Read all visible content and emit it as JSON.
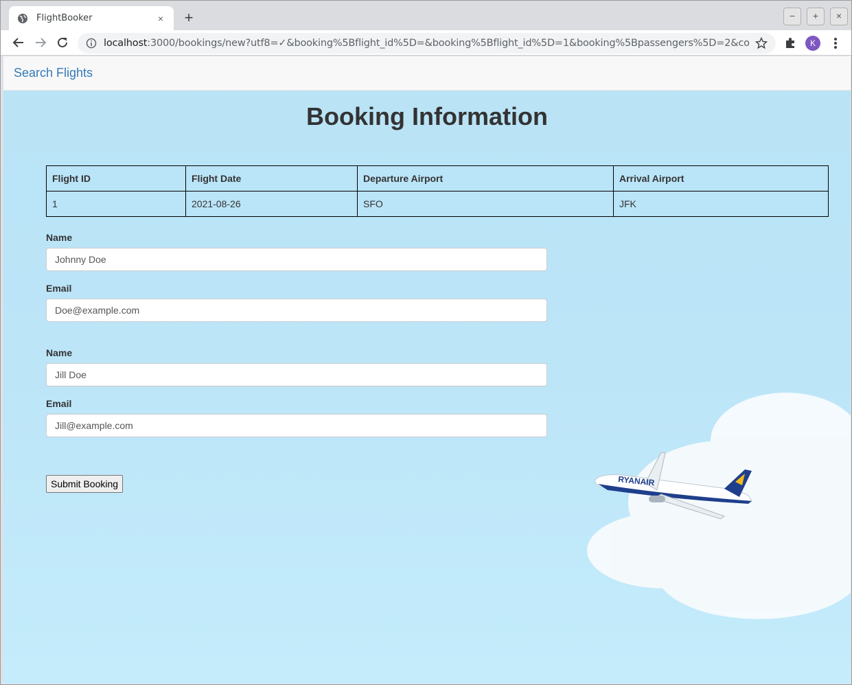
{
  "browser": {
    "tab_title": "FlightBooker",
    "url_host": "localhost",
    "url_rest": ":3000/bookings/new?utf8=✓&booking%5Bflight_id%5D=&booking%5Bflight_id%5D=1&booking%5Bpassengers%5D=2&commit=Co...",
    "profile_initial": "K",
    "win_minimize": "−",
    "win_maximize": "+",
    "win_close": "×",
    "new_tab": "+",
    "tab_close": "×"
  },
  "navbar": {
    "link": "Search Flights"
  },
  "page": {
    "title": "Booking Information"
  },
  "flight_table": {
    "headers": [
      "Flight ID",
      "Flight Date",
      "Departure Airport",
      "Arrival Airport"
    ],
    "row": [
      "1",
      "2021-08-26",
      "SFO",
      "JFK"
    ]
  },
  "passengers": [
    {
      "name_label": "Name",
      "name_value": "Johnny Doe",
      "email_label": "Email",
      "email_value": "Doe@example.com"
    },
    {
      "name_label": "Name",
      "name_value": "Jill Doe",
      "email_label": "Email",
      "email_value": "Jill@example.com"
    }
  ],
  "form": {
    "submit_label": "Submit Booking"
  },
  "colors": {
    "link": "#337ab7",
    "sky": "#bce5f8",
    "avatar": "#7e57c2"
  },
  "icons": [
    "globe-icon",
    "back-icon",
    "forward-icon",
    "reload-icon",
    "info-icon",
    "star-icon",
    "puzzle-icon",
    "menu-icon"
  ]
}
